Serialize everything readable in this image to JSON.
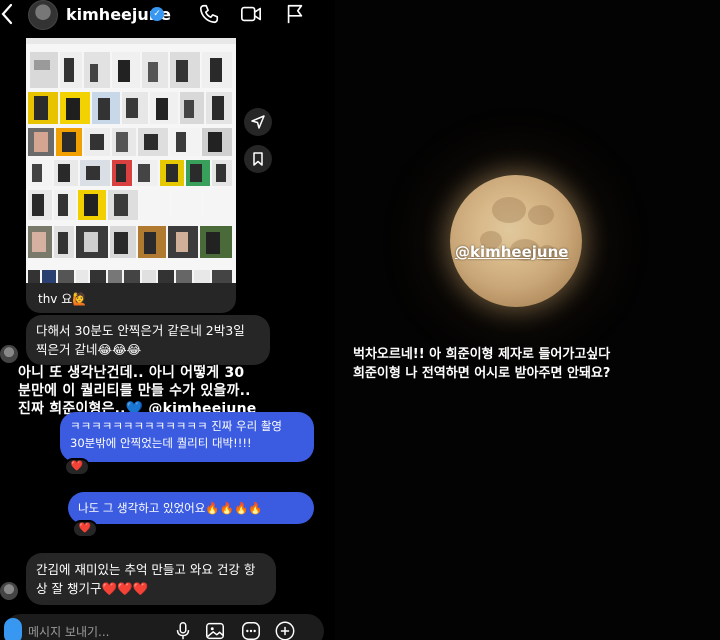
{
  "dm": {
    "header": {
      "username": "kimheejune"
    },
    "shared_post": {
      "caption": "thv 요🙋"
    },
    "messages": [
      {
        "side": "in",
        "text_line1": "다해서 30분도 안찍은거 같은네 2박3일",
        "text_line2": "찍은거 같네😂😂😂"
      },
      {
        "side": "out",
        "text_line1": "ㅋㅋㅋㅋㅋㅋㅋㅋㅋㅋㅋㅋㅋ 진짜 우리 촬영",
        "text_line2": "30분밖에 안찍었는데 퀄리티 대박!!!!",
        "reaction": "❤️"
      },
      {
        "side": "out",
        "text_line1": "나도 그 생각하고 있었어요🔥🔥🔥🔥",
        "reaction": "❤️"
      },
      {
        "side": "in",
        "text_line1": "간김에 재미있는 추억 만들고 와요 건강 항",
        "text_line2": "상 잘 챙기구❤️❤️❤️"
      }
    ],
    "overlay_caption": {
      "line1": "아니 또 생각난건데.. 아니 어떻게 30",
      "line2": "분만에 이 퀄리티를 만들 수가 있을까..",
      "line3": "진짜 희준이형은..💙 @kimheejune"
    },
    "composer": {
      "placeholder": "메시지 보내기..."
    }
  },
  "story": {
    "mention": "@kimheejune",
    "text_line1": "벅차오르네!! 아 희준이형 제자로 들어가고싶다",
    "text_line2": "희준이형 나 전역하면 어시로 받아주면 안돼요?"
  },
  "colors": {
    "outgoing_bubble": "#3b5ce0",
    "incoming_bubble": "#262626",
    "verified_badge": "#3897f0",
    "moon": "#d8b98a"
  }
}
